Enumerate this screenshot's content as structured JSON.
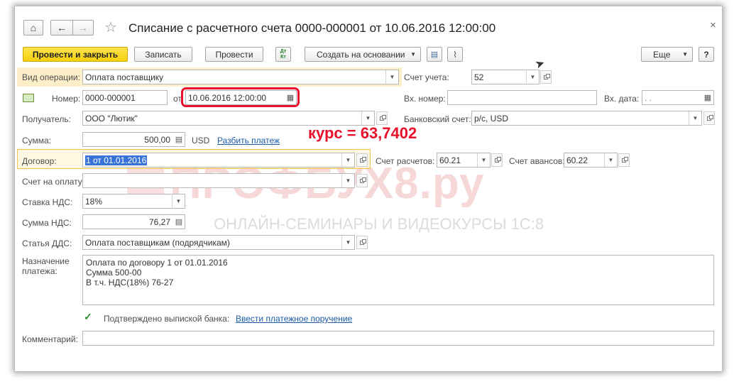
{
  "window": {
    "title": "Списание с расчетного счета 0000-000001 от 10.06.2016 12:00:00",
    "close_glyph": "×"
  },
  "toolbar": {
    "post_close": "Провести и закрыть",
    "save": "Записать",
    "post": "Провести",
    "dtkt": "Дт Кт",
    "create_based": "Создать на основании",
    "more": "Еще",
    "help": "?"
  },
  "form": {
    "operation_label": "Вид операции:",
    "operation_value": "Оплата поставщику",
    "account_label": "Счет учета:",
    "account_value": "52",
    "number_label": "Номер:",
    "number_value": "0000-000001",
    "from_label": "от",
    "date_value": "10.06.2016 12:00:00",
    "incoming_number_label": "Вх. номер:",
    "incoming_number_value": "",
    "incoming_date_label": "Вх. дата:",
    "incoming_date_value": " .  .",
    "recipient_label": "Получатель:",
    "recipient_value": "ООО \"Лютик\"",
    "bank_account_label": "Банковский счет:",
    "bank_account_value": "р/с, USD",
    "sum_label": "Сумма:",
    "sum_value": "500,00",
    "currency": "USD",
    "split_payment": "Разбить платеж",
    "rate_annotation": "курс = 63,7402",
    "contract_label": "Договор:",
    "contract_value": "1 от 01.01.2016",
    "settlement_account_label": "Счет расчетов:",
    "settlement_account_value": "60.21",
    "advance_account_label": "Счет авансов:",
    "advance_account_value": "60.22",
    "invoice_label": "Счет на оплату:",
    "invoice_value": "",
    "vat_rate_label": "Ставка НДС:",
    "vat_rate_value": "18%",
    "vat_sum_label": "Сумма НДС:",
    "vat_sum_value": "76,27",
    "dds_label": "Статья ДДС:",
    "dds_value": "Оплата поставщикам (подрядчикам)",
    "purpose_label_1": "Назначение",
    "purpose_label_2": "платежа:",
    "purpose_lines": [
      "Оплата по договору 1 от 01.01.2016",
      "Сумма 500-00",
      "В т.ч. НДС(18%) 76-27"
    ],
    "confirmed_label": "Подтверждено выпиской банка:",
    "enter_order_link": "Ввести платежное поручение",
    "comment_label": "Комментарий:",
    "comment_value": ""
  },
  "watermark": {
    "main": "ПРОФБУХ8.ру",
    "sub": "ОНЛАЙН-СЕМИНАРЫ И ВИДЕОКУРСЫ 1С:8"
  },
  "colors": {
    "accent_yellow": "#f6cf0c",
    "annotation_red": "#e8102a",
    "link_blue": "#1a5aa9",
    "highlight_field": "#f3c34a"
  }
}
